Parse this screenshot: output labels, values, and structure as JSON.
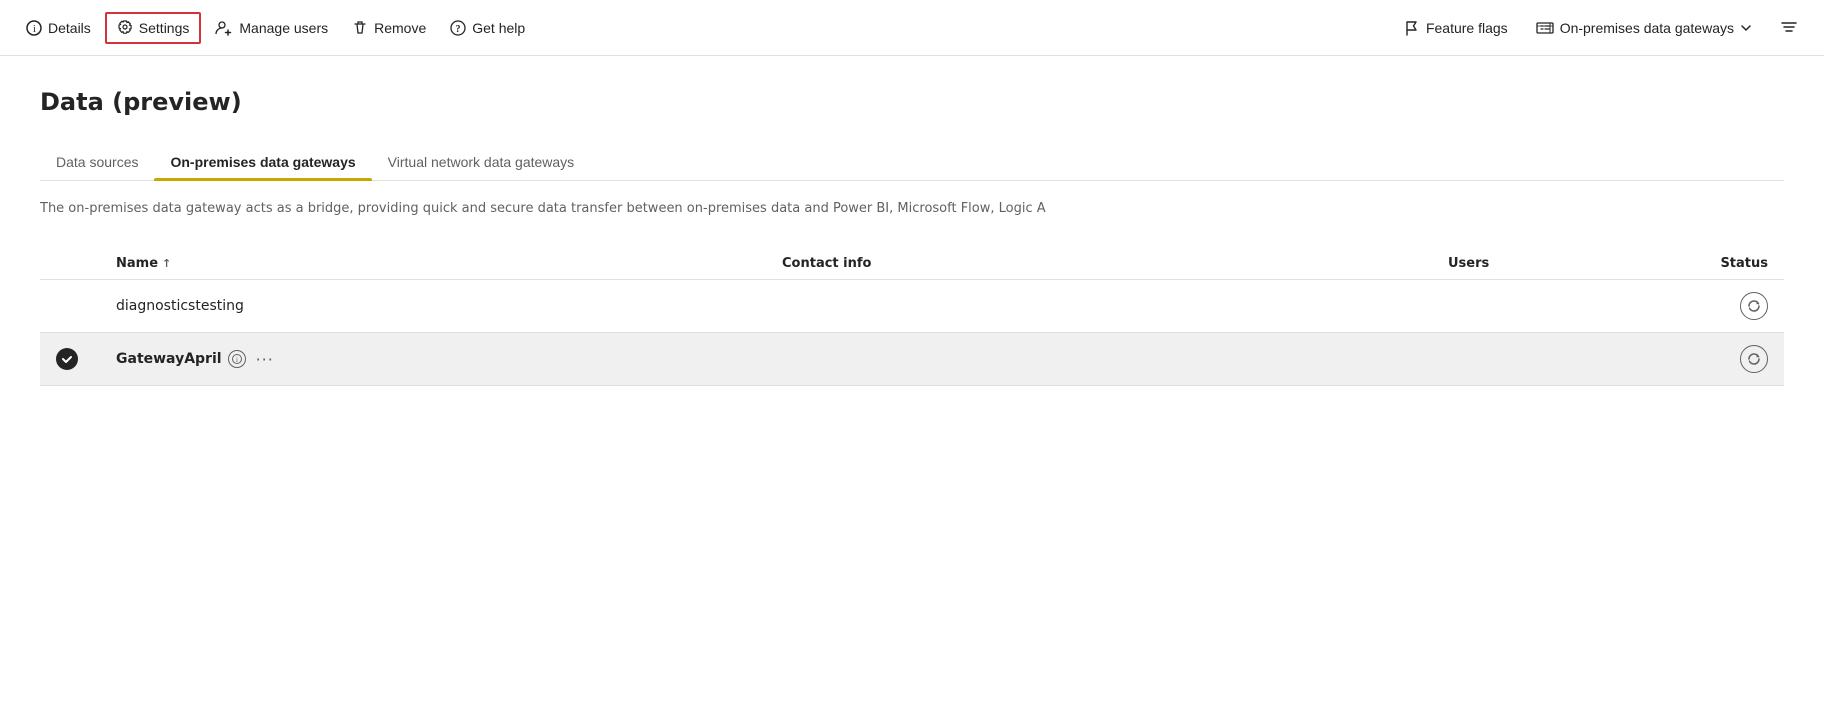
{
  "toolbar": {
    "details_label": "Details",
    "settings_label": "Settings",
    "manage_users_label": "Manage users",
    "remove_label": "Remove",
    "get_help_label": "Get help",
    "feature_flags_label": "Feature flags",
    "gateway_dropdown_label": "On-premises data gateways",
    "filter_icon_label": "≡"
  },
  "page": {
    "title": "Data (preview)",
    "description": "The on-premises data gateway acts as a bridge, providing quick and secure data transfer between on-premises data and Power BI, Microsoft Flow, Logic A"
  },
  "tabs": [
    {
      "id": "data-sources",
      "label": "Data sources",
      "active": false
    },
    {
      "id": "on-premises",
      "label": "On-premises data gateways",
      "active": true
    },
    {
      "id": "virtual-network",
      "label": "Virtual network data gateways",
      "active": false
    }
  ],
  "table": {
    "columns": [
      {
        "id": "selector",
        "label": ""
      },
      {
        "id": "name",
        "label": "Name",
        "sort": "↑"
      },
      {
        "id": "contact",
        "label": "Contact info"
      },
      {
        "id": "users",
        "label": "Users"
      },
      {
        "id": "status",
        "label": "Status"
      }
    ],
    "rows": [
      {
        "id": "row1",
        "selected": false,
        "name": "diagnosticstesting",
        "contact": "",
        "users": "",
        "status": "refresh"
      },
      {
        "id": "row2",
        "selected": true,
        "name": "GatewayApril",
        "contact": "",
        "users": "",
        "status": "refresh"
      }
    ]
  }
}
